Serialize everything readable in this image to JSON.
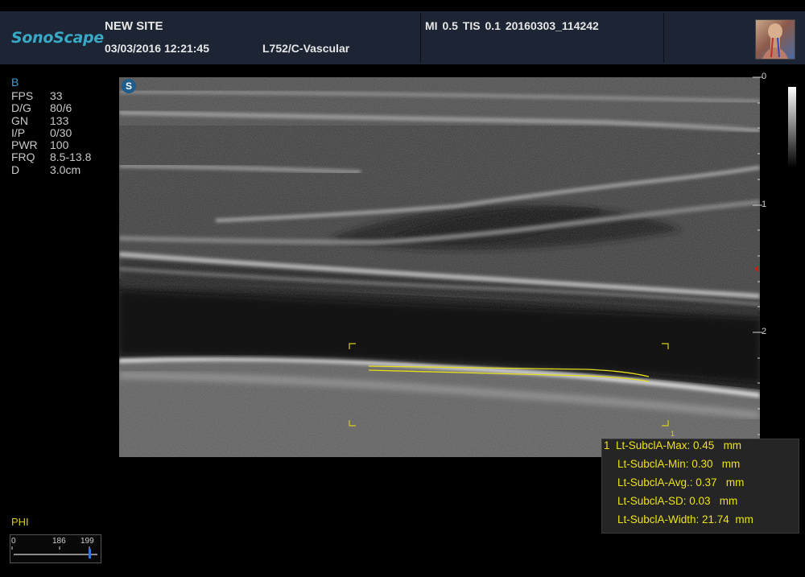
{
  "header": {
    "brand": "SonoScape",
    "site": "NEW SITE",
    "datetime": "03/03/2016 12:21:45",
    "probe_preset": "L752/C-Vascular",
    "mi_tis_id": "MI  0.5   TIS 0.1   20160303_114242",
    "thumbnail_icon": "body-neck-anatomy-icon"
  },
  "mode_label": "B",
  "params": [
    {
      "key": "FPS",
      "value": "33"
    },
    {
      "key": "D/G",
      "value": "80/6"
    },
    {
      "key": "GN",
      "value": "133"
    },
    {
      "key": "I/P",
      "value": "0/30"
    },
    {
      "key": "PWR",
      "value": "100"
    },
    {
      "key": "FRQ",
      "value": "8.5-13.8"
    },
    {
      "key": "D",
      "value": "3.0cm"
    }
  ],
  "image": {
    "badge": "S",
    "depth_ticks": [
      "0",
      "1",
      "2"
    ],
    "focus_marker_color": "#d11a1a",
    "roi_label": "1",
    "trace_color": "#e6de1a"
  },
  "measurements": [
    "1  Lt-SubclA-Max: 0.45   mm",
    "Lt-SubclA-Min: 0.30   mm",
    "Lt-SubclA-Avg.: 0.37   mm",
    "Lt-SubclA-SD: 0.03   mm",
    "Lt-SubclA-Width: 21.74  mm"
  ],
  "phi": {
    "label": "PHI",
    "min": "0",
    "mid": "186",
    "max": "199"
  }
}
